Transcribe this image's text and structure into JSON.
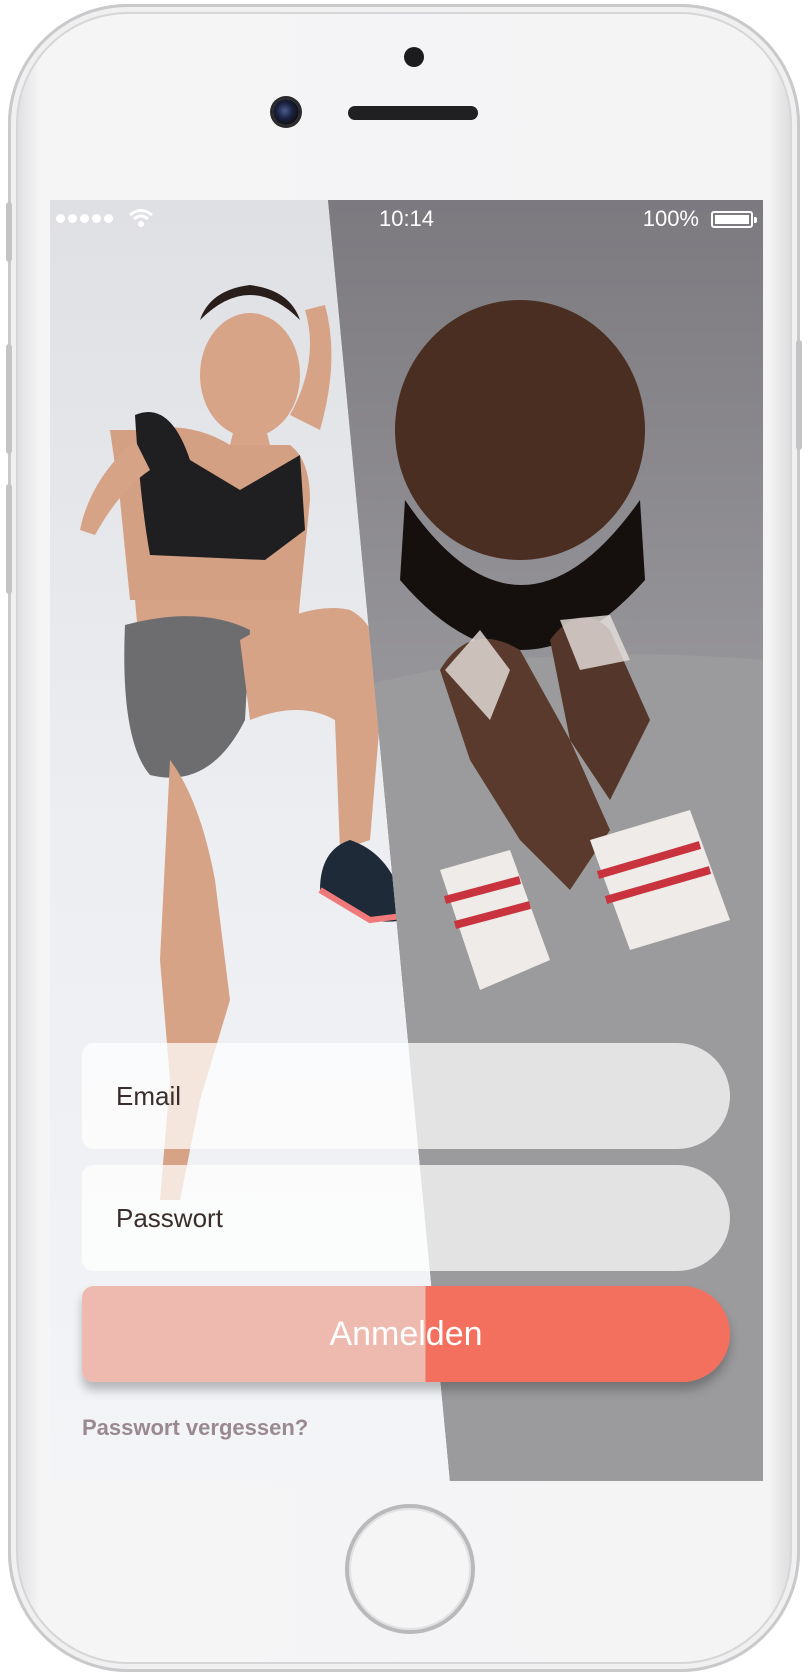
{
  "status_bar": {
    "time": "10:14",
    "battery": "100%",
    "signal_icon": "signal-dots-icon",
    "wifi_icon": "wifi-icon",
    "battery_icon": "battery-icon"
  },
  "login": {
    "email_placeholder": "Email",
    "password_placeholder": "Passwort",
    "submit_label": "Anmelden",
    "forgot_label": "Passwort vergessen?"
  },
  "colors": {
    "accent": "#f36f5e",
    "accent_light": "#eeb6aa"
  }
}
